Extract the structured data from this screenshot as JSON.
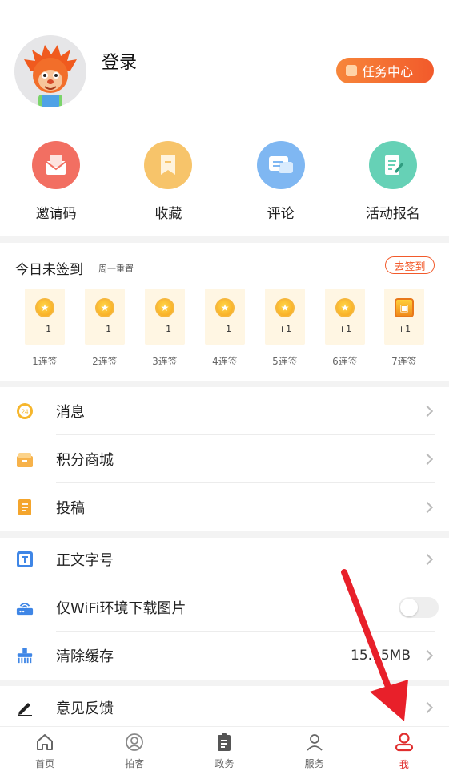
{
  "header": {
    "login_text": "登录",
    "task_center_label": "任务中心"
  },
  "quick_actions": [
    {
      "label": "邀请码",
      "icon": "mail-icon",
      "color": "#f26f62"
    },
    {
      "label": "收藏",
      "icon": "bookmark-icon",
      "color": "#f7c46a"
    },
    {
      "label": "评论",
      "icon": "comment-icon",
      "color": "#7fb7f2"
    },
    {
      "label": "活动报名",
      "icon": "signup-icon",
      "color": "#66d1b6"
    }
  ],
  "signin": {
    "title": "今日未签到",
    "subtitle": "周一重置",
    "button_label": "去签到",
    "days": [
      {
        "bonus": "+1",
        "label": "1连签"
      },
      {
        "bonus": "+1",
        "label": "2连签"
      },
      {
        "bonus": "+1",
        "label": "3连签"
      },
      {
        "bonus": "+1",
        "label": "4连签"
      },
      {
        "bonus": "+1",
        "label": "5连签"
      },
      {
        "bonus": "+1",
        "label": "6连签"
      },
      {
        "bonus": "+1",
        "label": "7连签"
      }
    ]
  },
  "menu1": [
    {
      "label": "消息",
      "icon": "message-icon"
    },
    {
      "label": "积分商城",
      "icon": "store-icon"
    },
    {
      "label": "投稿",
      "icon": "submit-icon"
    }
  ],
  "menu2": [
    {
      "label": "正文字号",
      "icon": "font-size-icon"
    },
    {
      "label": "仅WiFi环境下载图片",
      "icon": "wifi-icon",
      "toggle": false
    },
    {
      "label": "清除缓存",
      "icon": "clear-cache-icon",
      "value": "15.15MB"
    }
  ],
  "menu3": [
    {
      "label": "意见反馈",
      "icon": "feedback-icon"
    }
  ],
  "bottom_nav": [
    {
      "label": "首页",
      "icon": "home-icon"
    },
    {
      "label": "拍客",
      "icon": "camera-user-icon"
    },
    {
      "label": "政务",
      "icon": "clipboard-icon"
    },
    {
      "label": "服务",
      "icon": "person-icon"
    },
    {
      "label": "我",
      "icon": "me-icon",
      "active": true
    }
  ],
  "colors": {
    "accent": "#f25a2b",
    "active_tab": "#e02e2e",
    "arrow": "#e8202a"
  }
}
